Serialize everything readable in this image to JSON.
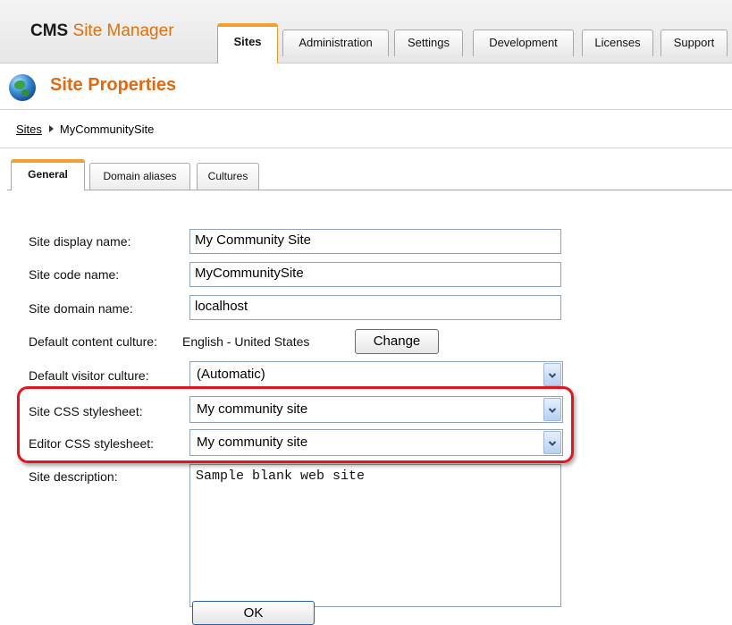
{
  "app": {
    "brand_bold": "CMS",
    "brand_rest": "Site Manager"
  },
  "top_tabs": [
    {
      "label": "Sites",
      "active": true
    },
    {
      "label": "Administration",
      "active": false
    },
    {
      "label": "Settings",
      "active": false
    },
    {
      "label": "Development",
      "active": false
    },
    {
      "label": "Licenses",
      "active": false
    },
    {
      "label": "Support",
      "active": false
    }
  ],
  "page": {
    "title": "Site Properties",
    "icon": "globe-icon"
  },
  "breadcrumb": {
    "root": "Sites",
    "current": "MyCommunitySite"
  },
  "sub_tabs": [
    {
      "label": "General",
      "active": true
    },
    {
      "label": "Domain aliases",
      "active": false
    },
    {
      "label": "Cultures",
      "active": false
    }
  ],
  "form": {
    "site_display_name": {
      "label": "Site display name:",
      "value": "My Community Site"
    },
    "site_code_name": {
      "label": "Site code name:",
      "value": "MyCommunitySite"
    },
    "site_domain_name": {
      "label": "Site domain name:",
      "value": "localhost"
    },
    "default_content_culture": {
      "label": "Default content culture:",
      "value": "English - United States",
      "button": "Change"
    },
    "default_visitor_culture": {
      "label": "Default visitor culture:",
      "value": "(Automatic)"
    },
    "site_css": {
      "label": "Site CSS stylesheet:",
      "value": "My community site"
    },
    "editor_css": {
      "label": "Editor CSS stylesheet:",
      "value": "My community site"
    },
    "site_description": {
      "label": "Site description:",
      "value": "Sample blank web site"
    },
    "ok_button": "OK"
  },
  "colors": {
    "accent": "#e06a10",
    "tab_highlight": "#f0a030",
    "callout": "#e0161e"
  }
}
